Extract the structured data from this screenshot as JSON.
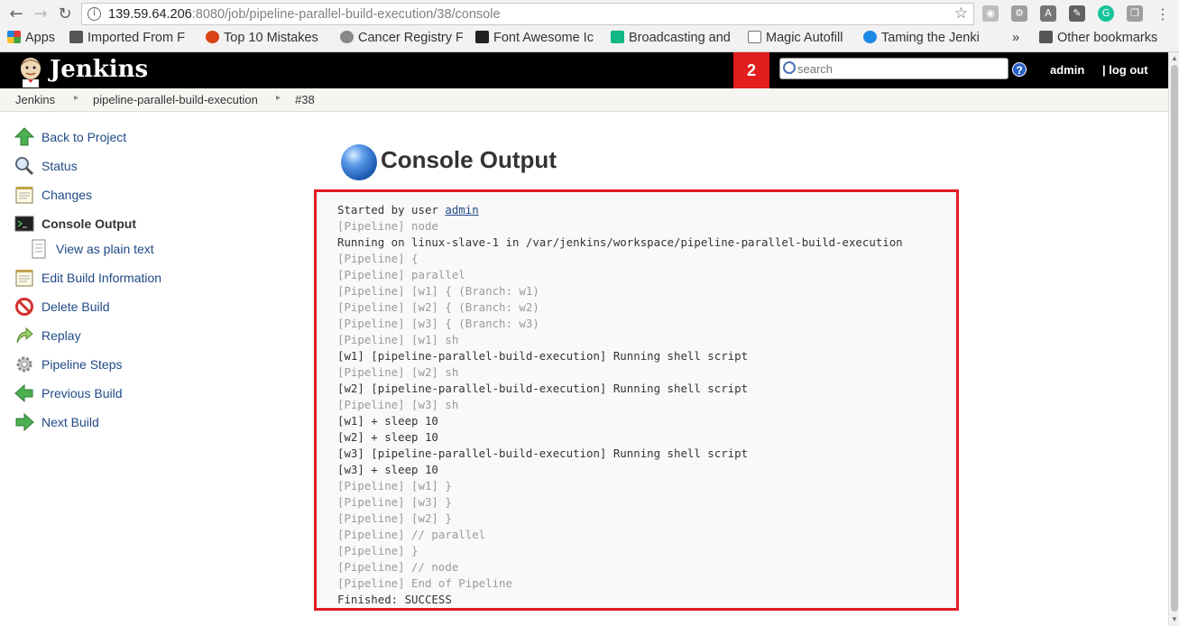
{
  "browser": {
    "url_host": "139.59.64.206",
    "url_rest": ":8080/job/pipeline-parallel-build-execution/38/console",
    "bookmarks": [
      {
        "label": "Apps"
      },
      {
        "label": "Imported From F"
      },
      {
        "label": "Top 10 Mistakes"
      },
      {
        "label": "Cancer Registry F"
      },
      {
        "label": "Font Awesome Ic"
      },
      {
        "label": "Broadcasting and"
      },
      {
        "label": "Magic Autofill"
      },
      {
        "label": "Taming the Jenki"
      },
      {
        "label": "»"
      },
      {
        "label": "Other bookmarks"
      }
    ]
  },
  "header": {
    "title": "Jenkins",
    "notifications": "2",
    "search_placeholder": "search",
    "help": "?",
    "user": "admin",
    "logout": "| log out"
  },
  "breadcrumb": [
    "Jenkins",
    "pipeline-parallel-build-execution",
    "#38"
  ],
  "sidebar": {
    "items": [
      {
        "label": "Back to Project",
        "icon": "up-arrow-icon"
      },
      {
        "label": "Status",
        "icon": "magnifier-icon"
      },
      {
        "label": "Changes",
        "icon": "notepad-icon"
      },
      {
        "label": "Console Output",
        "icon": "terminal-icon"
      },
      {
        "label": "View as plain text",
        "icon": "document-icon"
      },
      {
        "label": "Edit Build Information",
        "icon": "notepad-icon"
      },
      {
        "label": "Delete Build",
        "icon": "no-entry-icon"
      },
      {
        "label": "Replay",
        "icon": "replay-arrow-icon"
      },
      {
        "label": "Pipeline Steps",
        "icon": "gear-icon"
      },
      {
        "label": "Previous Build",
        "icon": "left-arrow-icon"
      },
      {
        "label": "Next Build",
        "icon": "right-arrow-icon"
      }
    ]
  },
  "main": {
    "title": "Console Output",
    "console": {
      "started_prefix": "Started by user ",
      "started_user": "admin",
      "lines": [
        {
          "text": "[Pipeline] node",
          "dim": true
        },
        {
          "text": "Running on linux-slave-1 in /var/jenkins/workspace/pipeline-parallel-build-execution",
          "dim": false
        },
        {
          "text": "[Pipeline] {",
          "dim": true
        },
        {
          "text": "[Pipeline] parallel",
          "dim": true
        },
        {
          "text": "[Pipeline] [w1] { (Branch: w1)",
          "dim": true
        },
        {
          "text": "[Pipeline] [w2] { (Branch: w2)",
          "dim": true
        },
        {
          "text": "[Pipeline] [w3] { (Branch: w3)",
          "dim": true
        },
        {
          "text": "[Pipeline] [w1] sh",
          "dim": true
        },
        {
          "text": "[w1] [pipeline-parallel-build-execution] Running shell script",
          "dim": false
        },
        {
          "text": "[Pipeline] [w2] sh",
          "dim": true
        },
        {
          "text": "[w2] [pipeline-parallel-build-execution] Running shell script",
          "dim": false
        },
        {
          "text": "[Pipeline] [w3] sh",
          "dim": true
        },
        {
          "text": "[w1] + sleep 10",
          "dim": false
        },
        {
          "text": "[w2] + sleep 10",
          "dim": false
        },
        {
          "text": "[w3] [pipeline-parallel-build-execution] Running shell script",
          "dim": false
        },
        {
          "text": "[w3] + sleep 10",
          "dim": false
        },
        {
          "text": "[Pipeline] [w1] }",
          "dim": true
        },
        {
          "text": "[Pipeline] [w3] }",
          "dim": true
        },
        {
          "text": "[Pipeline] [w2] }",
          "dim": true
        },
        {
          "text": "[Pipeline] // parallel",
          "dim": true
        },
        {
          "text": "[Pipeline] }",
          "dim": true
        },
        {
          "text": "[Pipeline] // node",
          "dim": true
        },
        {
          "text": "[Pipeline] End of Pipeline",
          "dim": true
        },
        {
          "text": "Finished: SUCCESS",
          "dim": false
        }
      ]
    }
  },
  "colors": {
    "header_bg": "#000000",
    "notification_bg": "#e11d1d",
    "highlight_border": "#e31b23",
    "link": "#204a87"
  }
}
